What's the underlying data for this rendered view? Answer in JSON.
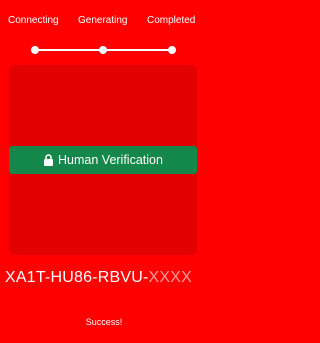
{
  "steps": [
    {
      "label": "Connecting"
    },
    {
      "label": "Generating"
    },
    {
      "label": "Completed"
    }
  ],
  "progress": {
    "completed_steps": 3,
    "total_steps": 3
  },
  "verify_button": {
    "label": "Human Verification",
    "icon": "lock-icon"
  },
  "code": {
    "visible": "XA1T-HU86-RBVU-",
    "masked": "XXXX"
  },
  "status": {
    "text": "Success!"
  },
  "colors": {
    "background": "#ff0000",
    "panel": "#e30000",
    "button": "#14874a",
    "masked_text": "#ff9a9a"
  }
}
